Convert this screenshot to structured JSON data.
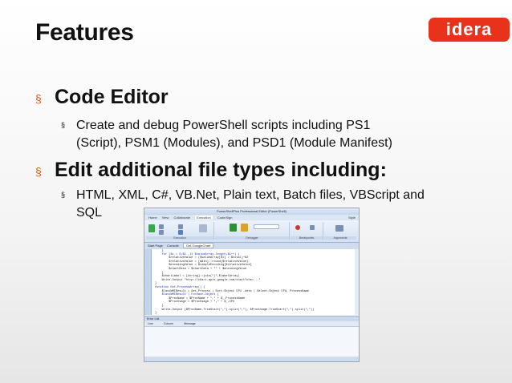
{
  "slide": {
    "title": "Features",
    "logo_text": "idera",
    "bullets": [
      {
        "text": "Code Editor",
        "sub": [
          {
            "lines": [
              "Create and debug PowerShell scripts including PS1",
              "(Script), PSM1 (Modules), and PSD1 (Module Manifest)"
            ]
          }
        ]
      },
      {
        "text": "Edit additional file types including:",
        "sub": [
          {
            "lines": [
              "HTML, XML, C#, VB.Net, Plain text, Batch files, VBScript and",
              "SQL"
            ]
          }
        ]
      }
    ],
    "bullet_glyph": "§"
  },
  "editor": {
    "window_title": "PowerShellPlus Professional Editor (PowerShell)",
    "menu": [
      "Home",
      "View",
      "Collaborate",
      "Execution",
      "Code/Sign"
    ],
    "menu_right": "Style",
    "ribbon_groups": [
      "Execution",
      "Debugger",
      "Breakpoints",
      "Arguments"
    ],
    "tabs": [
      "Start Page",
      "Console",
      "Get-GoogleChart"
    ],
    "code_lines": [
      {
        "n": "",
        "t": "    }"
      },
      {
        "n": "",
        "t": "    for ($i = 0;$i -lt $valueArray.length;$i++) {"
      },
      {
        "n": "",
        "t": "        $relativeValue = ($valueArray[$i] / $total)*62"
      },
      {
        "n": "",
        "t": "        $relativeValue = [math]::round($relativeValue)"
      },
      {
        "n": "",
        "t": "        $encodingValue = $simpleEncoding[$relativeValue]"
      },
      {
        "n": "",
        "t": "        $chartData = $chartData + \"\" + $encodingValue"
      },
      {
        "n": "",
        "t": "    }"
      },
      {
        "n": "",
        "t": "    $chartLabel = [string]::join(\"|\",$labelArray)"
      },
      {
        "n": "",
        "t": "    Write-Output \"http://chart.apis.google.com/chart?chs=...\""
      },
      {
        "n": "",
        "t": "}"
      },
      {
        "n": "",
        "t": ""
      },
      {
        "n": "",
        "t": "function Get-ProcessArray() {"
      },
      {
        "n": "",
        "t": "    $lastWMIResult = Get-Process | Sort-Object CPU -desc | Select-Object CPU, ProcessName"
      },
      {
        "n": "",
        "t": "    $lastWMIResult | ForEach-Object {"
      },
      {
        "n": "",
        "t": "        $ProcName = $ProcName + \",\" + $_.ProcessName"
      },
      {
        "n": "",
        "t": "        $ProcUsage = $ProcUsage + \",\" + $_.CPU"
      },
      {
        "n": "",
        "t": "    }"
      },
      {
        "n": "",
        "t": "    Write-Output ($ProcName.TrimStart(\",\").split(\",\"), $ProcUsage.TrimStart(\",\").split(\",\"))"
      },
      {
        "n": "",
        "t": "}"
      }
    ],
    "error_panel": {
      "title": "Error List",
      "columns": [
        "Line",
        "Column",
        "Message"
      ]
    }
  }
}
